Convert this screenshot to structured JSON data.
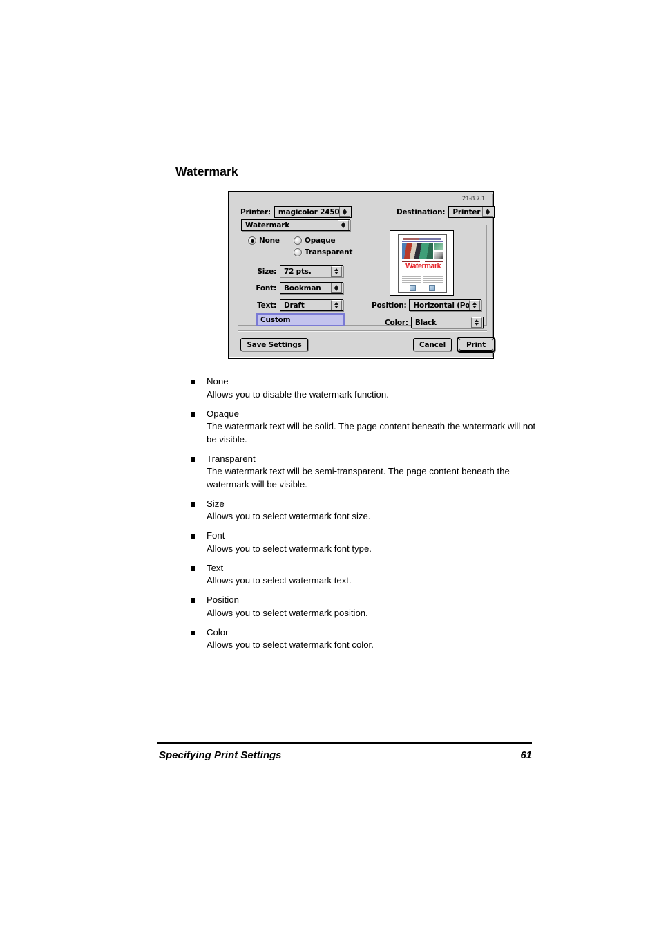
{
  "page": {
    "heading": "Watermark",
    "footer_title": "Specifying Print Settings",
    "footer_page_number": "61"
  },
  "dialog": {
    "version_label": "21-8.7.1",
    "printer_row": {
      "printer_label": "Printer:",
      "printer_value": "magicolor 2450",
      "destination_label": "Destination:",
      "destination_value": "Printer"
    },
    "pane_popup_value": "Watermark",
    "mode_radios": [
      {
        "label": "None",
        "selected": true
      },
      {
        "label": "Opaque",
        "selected": false
      },
      {
        "label": "Transparent",
        "selected": false
      }
    ],
    "fields": {
      "size_label": "Size:",
      "size_value": "72 pts.",
      "font_label": "Font:",
      "font_value": "Bookman",
      "text_label": "Text:",
      "text_value": "Draft",
      "custom_value": "Custom",
      "position_label": "Position:",
      "position_value": "Horizontal (Por...",
      "color_label": "Color:",
      "color_value": "Black"
    },
    "preview": {
      "watermark_text": "Watermark",
      "watermark_color": "#e8242a"
    },
    "buttons": {
      "save_settings": "Save Settings",
      "cancel": "Cancel",
      "print": "Print"
    }
  },
  "body_items": [
    {
      "term": "None",
      "desc": "Allows you to disable the watermark function."
    },
    {
      "term": "Opaque",
      "desc": "The watermark text will be solid. The page content beneath the watermark will not be visible."
    },
    {
      "term": "Transparent",
      "desc": "The watermark text will be semi-transparent. The page content beneath the watermark will be visible."
    },
    {
      "term": "Size",
      "desc": "Allows you to select watermark font size."
    },
    {
      "term": "Font",
      "desc": "Allows you to select watermark font type."
    },
    {
      "term": "Text",
      "desc": "Allows you to select watermark text."
    },
    {
      "term": "Position",
      "desc": "Allows you to select watermark position."
    },
    {
      "term": "Color",
      "desc": "Allows you to select watermark font color."
    }
  ]
}
